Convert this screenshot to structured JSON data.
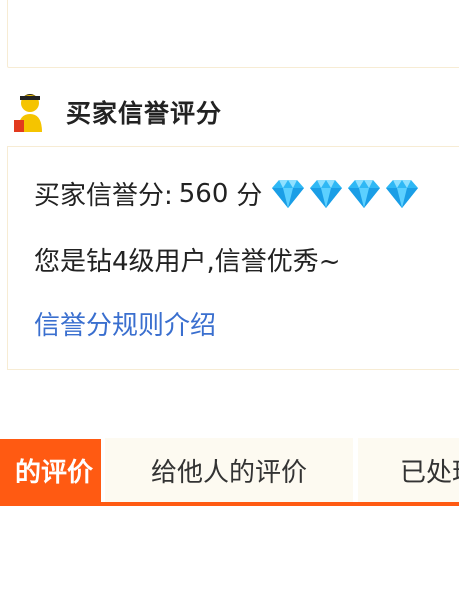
{
  "section": {
    "title": "买家信誉评分",
    "icon": "buyer-avatar-icon"
  },
  "credit": {
    "score_label": "买家信誉分:",
    "score_value": "560",
    "score_unit": "分",
    "diamond_count": 4,
    "diamond_icon": "diamond-icon",
    "level_text": "您是钻4级用户,信誉优秀~",
    "rules_link": "信誉分规则介绍"
  },
  "tabs": [
    {
      "label": "的评价",
      "active": true
    },
    {
      "label": "给他人的评价",
      "active": false
    },
    {
      "label": "已处理",
      "active": false
    }
  ],
  "colors": {
    "accent": "#ff5a12",
    "link": "#3a6fcf",
    "diamond": "#2fb8f5",
    "border": "#f7ecd4",
    "tab_bg": "#fdfaf1"
  }
}
